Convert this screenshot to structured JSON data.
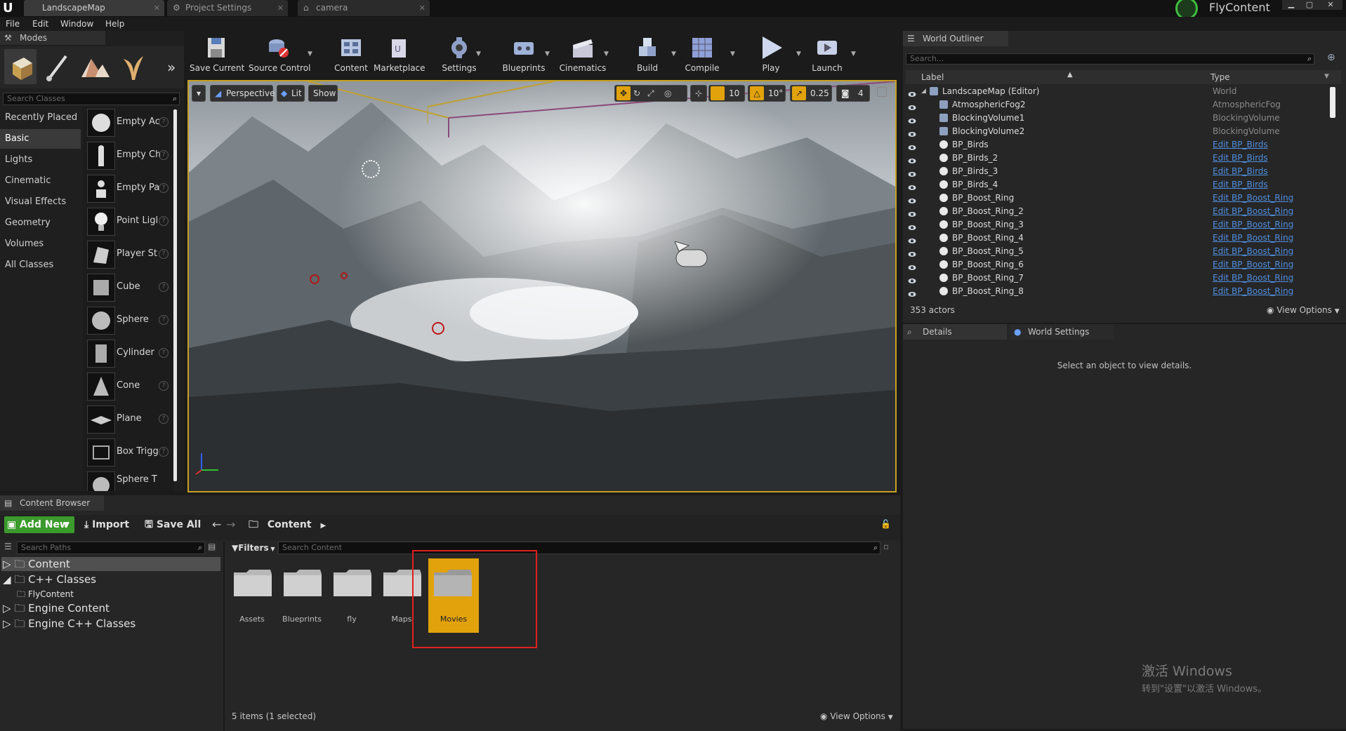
{
  "tabs": [
    {
      "label": "LandscapeMap"
    },
    {
      "label": "Project Settings"
    },
    {
      "label": "camera"
    }
  ],
  "project_name": "FlyContent",
  "menu": [
    "File",
    "Edit",
    "Window",
    "Help"
  ],
  "modes": {
    "title": "Modes",
    "search_placeholder": "Search Classes",
    "categories": [
      "Recently Placed",
      "Basic",
      "Lights",
      "Cinematic",
      "Visual Effects",
      "Geometry",
      "Volumes",
      "All Classes"
    ],
    "items": [
      "Empty Ac",
      "Empty Ch",
      "Empty Pa",
      "Point Ligl",
      "Player St",
      "Cube",
      "Sphere",
      "Cylinder",
      "Cone",
      "Plane",
      "Box Trigg",
      "Sphere T"
    ]
  },
  "toolbar": {
    "buttons": [
      "Save Current",
      "Source Control",
      "Content",
      "Marketplace",
      "Settings",
      "Blueprints",
      "Cinematics",
      "Build",
      "Compile",
      "Play",
      "Launch"
    ]
  },
  "viewport": {
    "perspective": "Perspective",
    "lit": "Lit",
    "show": "Show",
    "grid_snap": "10",
    "rotation_snap": "10°",
    "scale_snap": "0.25",
    "camera_speed": "4"
  },
  "outliner": {
    "title": "World Outliner",
    "search_placeholder": "Search...",
    "col_label": "Label",
    "col_type": "Type",
    "rows": [
      {
        "label": "LandscapeMap (Editor)",
        "type": "World",
        "link": false
      },
      {
        "label": "AtmosphericFog2",
        "type": "AtmosphericFog",
        "link": false
      },
      {
        "label": "BlockingVolume1",
        "type": "BlockingVolume",
        "link": false
      },
      {
        "label": "BlockingVolume2",
        "type": "BlockingVolume",
        "link": false
      },
      {
        "label": "BP_Birds",
        "type": "Edit BP_Birds",
        "link": true
      },
      {
        "label": "BP_Birds_2",
        "type": "Edit BP_Birds",
        "link": true
      },
      {
        "label": "BP_Birds_3",
        "type": "Edit BP_Birds",
        "link": true
      },
      {
        "label": "BP_Birds_4",
        "type": "Edit BP_Birds",
        "link": true
      },
      {
        "label": "BP_Boost_Ring",
        "type": "Edit BP_Boost_Ring",
        "link": true
      },
      {
        "label": "BP_Boost_Ring_2",
        "type": "Edit BP_Boost_Ring",
        "link": true
      },
      {
        "label": "BP_Boost_Ring_3",
        "type": "Edit BP_Boost_Ring",
        "link": true
      },
      {
        "label": "BP_Boost_Ring_4",
        "type": "Edit BP_Boost_Ring",
        "link": true
      },
      {
        "label": "BP_Boost_Ring_5",
        "type": "Edit BP_Boost_Ring",
        "link": true
      },
      {
        "label": "BP_Boost_Ring_6",
        "type": "Edit BP_Boost_Ring",
        "link": true
      },
      {
        "label": "BP_Boost_Ring_7",
        "type": "Edit BP_Boost_Ring",
        "link": true
      },
      {
        "label": "BP_Boost_Ring_8",
        "type": "Edit BP_Boost_Ring",
        "link": true
      }
    ],
    "actor_count": "353 actors",
    "view_options": "View Options"
  },
  "details": {
    "tab_details": "Details",
    "tab_world_settings": "World Settings",
    "empty_message": "Select an object to view details."
  },
  "content_browser": {
    "title": "Content Browser",
    "add_new": "Add New",
    "import": "Import",
    "save_all": "Save All",
    "breadcrumb": "Content",
    "paths_placeholder": "Search Paths",
    "filters": "Filters",
    "content_placeholder": "Search Content",
    "tree": [
      {
        "label": "Content",
        "level": 0
      },
      {
        "label": "C++ Classes",
        "level": 0
      },
      {
        "label": "FlyContent",
        "level": 1
      },
      {
        "label": "Engine Content",
        "level": 0
      },
      {
        "label": "Engine C++ Classes",
        "level": 0
      }
    ],
    "folders": [
      "Assets",
      "Blueprints",
      "fly",
      "Maps",
      "Movies"
    ],
    "selected_folder": "Movies",
    "status": "5 items (1 selected)",
    "view_options": "View Options"
  },
  "watermark": {
    "line1": "激活 Windows",
    "line2": "转到\"设置\"以激活 Windows。"
  },
  "colors": {
    "selection": "#e2a20b",
    "highlight_box": "#e02020",
    "add_new": "#3b9a2c",
    "link": "#4f8fe0"
  }
}
